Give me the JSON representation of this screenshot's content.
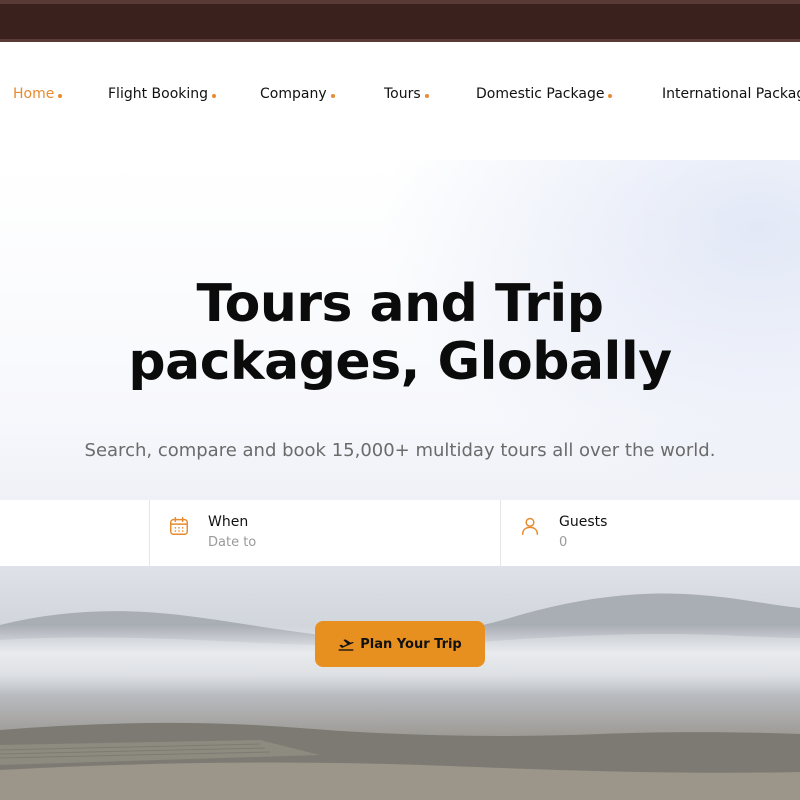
{
  "colors": {
    "accent": "#e88a2e",
    "topbar": "#3a211e",
    "button": "#e8901f"
  },
  "nav": {
    "items": [
      {
        "label": "Home",
        "active": true
      },
      {
        "label": "Flight Booking"
      },
      {
        "label": "Company"
      },
      {
        "label": "Tours"
      },
      {
        "label": "Domestic Package"
      },
      {
        "label": "International Package"
      }
    ]
  },
  "hero": {
    "title_line1": "Tours and Trip",
    "title_line2": "packages, Globally",
    "subtitle": "Search, compare and book 15,000+ multiday tours all over the world."
  },
  "search": {
    "when": {
      "label": "When",
      "value": "Date to",
      "icon": "calendar-icon"
    },
    "guests": {
      "label": "Guests",
      "value": "0",
      "icon": "user-icon"
    }
  },
  "cta": {
    "label": "Plan Your Trip",
    "icon": "plane-departure-icon"
  }
}
